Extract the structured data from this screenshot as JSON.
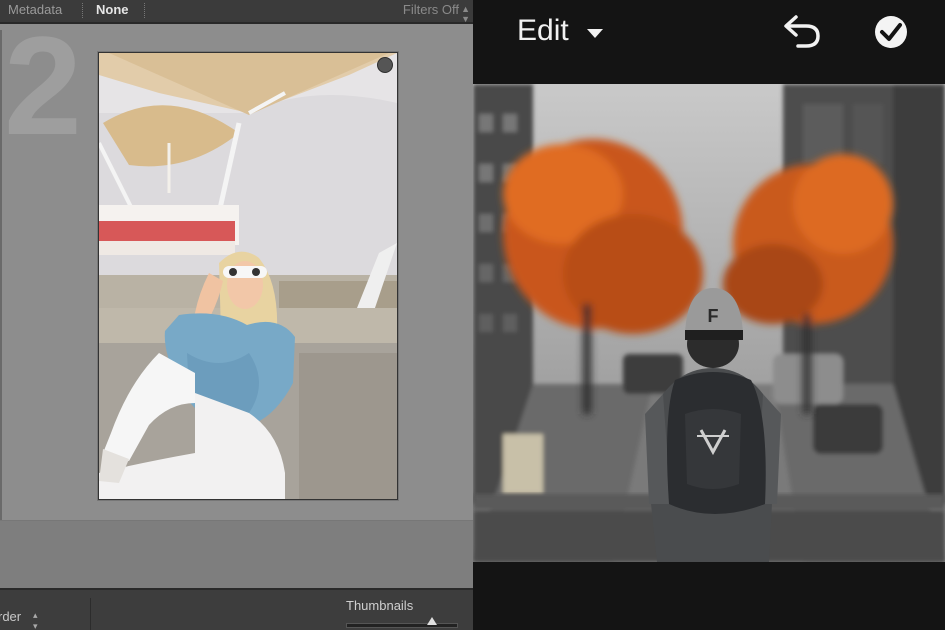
{
  "left_panel": {
    "filter_bar": {
      "metadata_label": "Metadata",
      "none_label": "None",
      "filters_label": "Filters Off"
    },
    "grid": {
      "cell_number": "2",
      "photo_icon": "ferris-wheel-portrait-photo",
      "badge_icon": "circle-badge-icon"
    },
    "toolbar": {
      "sort_label": "rder",
      "thumbnails_label": "Thumbnails",
      "thumbnail_slider_value": 0.78
    }
  },
  "right_panel": {
    "title": "Edit",
    "icons": {
      "caret": "caret-down-icon",
      "undo": "undo-arrow-icon",
      "done": "checkmark-circle-icon"
    },
    "photo_icon": "city-street-backpacker-photo"
  },
  "colors": {
    "lightroom_gray": "#8f8f8f",
    "mobile_dark": "#141414",
    "autumn_orange": "#d9641a"
  }
}
